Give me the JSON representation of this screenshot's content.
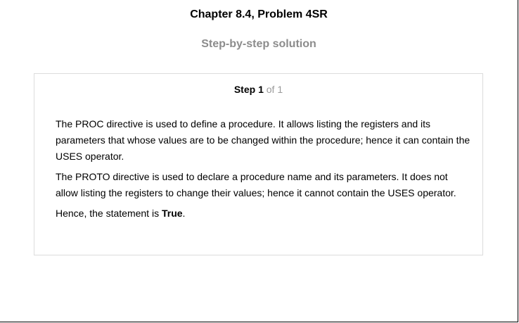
{
  "header": {
    "title": "Chapter 8.4, Problem 4SR",
    "subtitle": "Step-by-step solution"
  },
  "step": {
    "word": "Step",
    "number": "1",
    "of_word": "of",
    "total": "1"
  },
  "solution": {
    "paragraph1": "The PROC directive is used to define a procedure. It allows listing the registers and its parameters that whose values are to be changed within the procedure; hence it can contain the USES operator.",
    "paragraph2": "The PROTO directive is used to declare a procedure name and its parameters. It does not allow listing the registers to change their values; hence it cannot contain the USES operator.",
    "conclusion_prefix": "Hence, the statement is ",
    "conclusion_answer": "True",
    "conclusion_suffix": "."
  },
  "colors": {
    "title_text": "#000000",
    "subtitle_text": "#8c8c8c",
    "card_border": "#dcdcdc",
    "step_muted": "#9a9a9a"
  }
}
